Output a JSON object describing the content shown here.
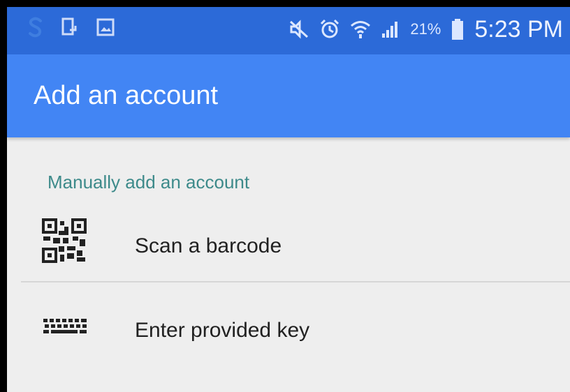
{
  "status_bar": {
    "icons_left": [
      "s-icon",
      "notification-icon",
      "image-icon"
    ],
    "icons_right": [
      "mute-icon",
      "alarm-icon",
      "wifi-icon",
      "signal-icon",
      "battery-icon"
    ],
    "battery_percent": "21%",
    "time": "5:23 PM"
  },
  "app_bar": {
    "title": "Add an account",
    "color": "#4285f4"
  },
  "section": {
    "header": "Manually add an account",
    "items": [
      {
        "label": "Scan a barcode",
        "icon": "qr-code-icon"
      },
      {
        "label": "Enter provided key",
        "icon": "keyboard-icon"
      }
    ]
  }
}
